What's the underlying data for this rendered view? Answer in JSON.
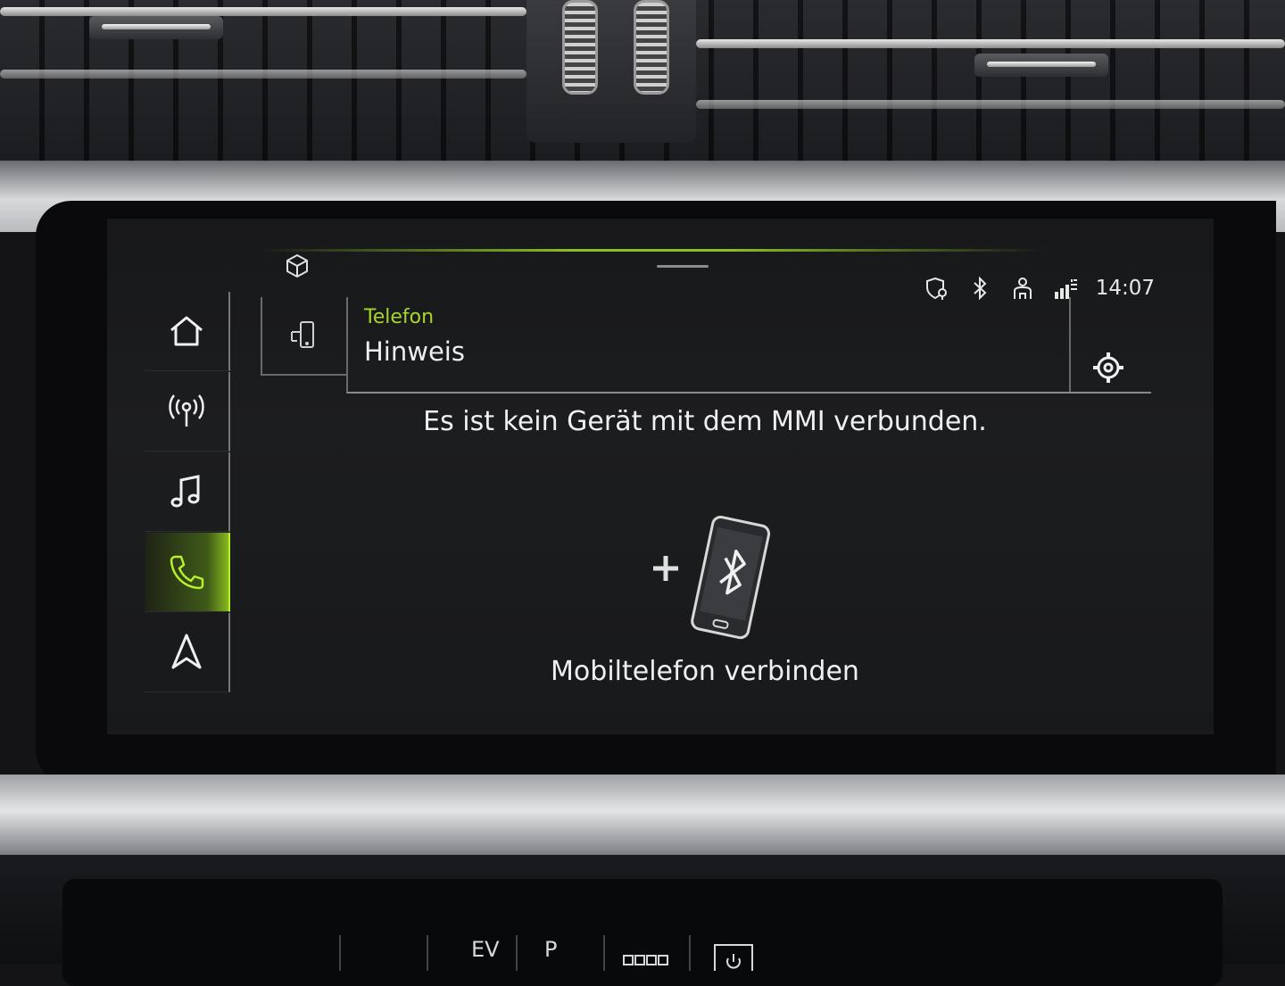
{
  "screen": {
    "breadcrumb": "Telefon",
    "title": "Hinweis",
    "clock": "14:07",
    "message": "Es ist kein Gerät mit dem MMI verbunden.",
    "connect_label": "Mobiltelefon verbinden",
    "accent_color": "#a6d62a"
  },
  "sidebar": {
    "items": [
      {
        "name": "home",
        "icon": "home-icon",
        "active": false
      },
      {
        "name": "radio",
        "icon": "radio-antenna-icon",
        "active": false
      },
      {
        "name": "media",
        "icon": "music-note-icon",
        "active": false
      },
      {
        "name": "phone",
        "icon": "phone-handset-icon",
        "active": true
      },
      {
        "name": "navigation",
        "icon": "navigation-arrow-icon",
        "active": false
      }
    ]
  },
  "status_bar": {
    "icons": [
      "location-shield-icon",
      "bluetooth-icon",
      "user-profile-icon",
      "data-signal-icon"
    ]
  },
  "lower_console": {
    "labels": [
      "EV",
      "P"
    ]
  }
}
